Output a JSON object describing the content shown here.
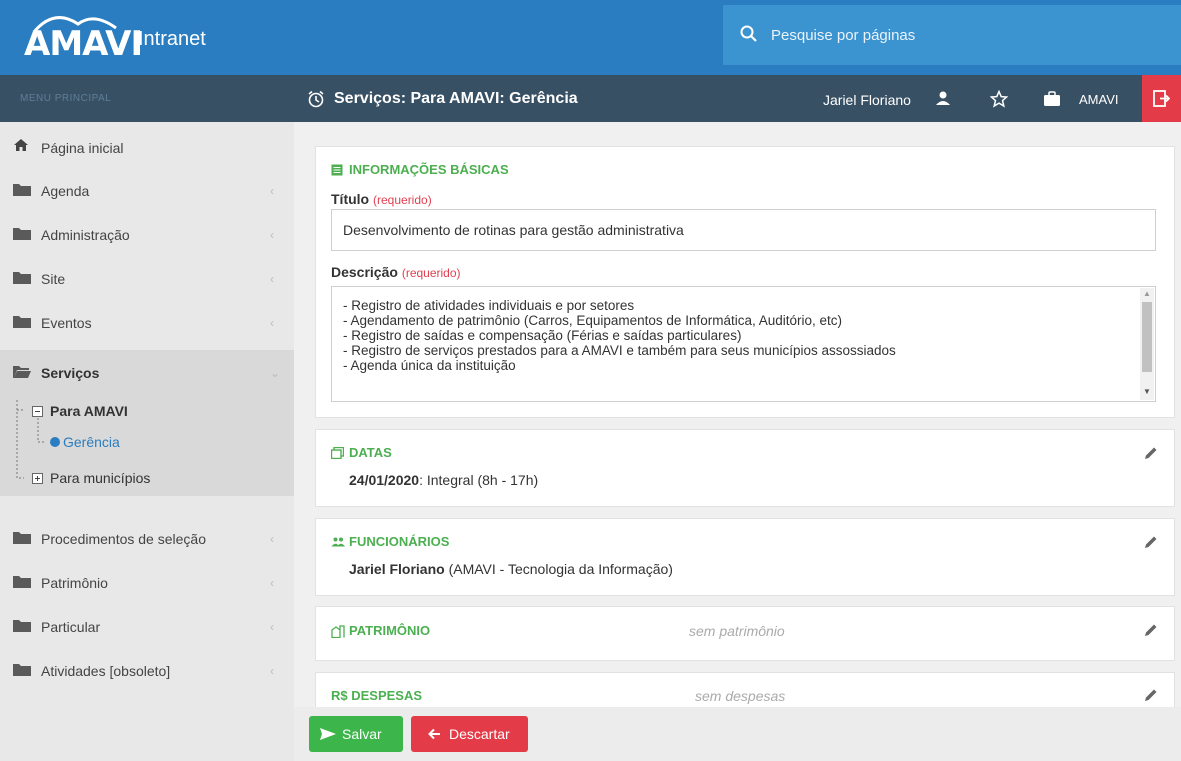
{
  "header": {
    "logo_text": "AMAVI",
    "app_title": "Intranet",
    "search_placeholder": "Pesquise por páginas"
  },
  "navbar": {
    "menu_label": "MENU PRINCIPAL",
    "page_title": "Serviços: Para AMAVI: Gerência",
    "user_name": "Jariel Floriano",
    "org_label": "AMAVI"
  },
  "sidebar": {
    "items": [
      {
        "label": "Página inicial",
        "icon": "home-icon"
      },
      {
        "label": "Agenda",
        "icon": "folder-icon"
      },
      {
        "label": "Administração",
        "icon": "folder-icon"
      },
      {
        "label": "Site",
        "icon": "folder-icon"
      },
      {
        "label": "Eventos",
        "icon": "folder-icon"
      },
      {
        "label": "Serviços",
        "icon": "folder-open-icon"
      },
      {
        "label": "Procedimentos de seleção",
        "icon": "folder-icon"
      },
      {
        "label": "Patrimônio",
        "icon": "folder-icon"
      },
      {
        "label": "Particular",
        "icon": "folder-icon"
      },
      {
        "label": "Atividades [obsoleto]",
        "icon": "folder-icon"
      }
    ],
    "tree": {
      "para_amavi": "Para AMAVI",
      "gerencia": "Gerência",
      "para_municipios": "Para municípios"
    }
  },
  "basic_info": {
    "section_title": "INFORMAÇÕES BÁSICAS",
    "title_label": "Título",
    "title_required": "(requerido)",
    "title_value": "Desenvolvimento de rotinas para gestão administrativa",
    "description_label": "Descrição",
    "description_required": "(requerido)",
    "description_lines": [
      "- Registro de atividades individuais e por setores",
      "- Agendamento de patrimônio (Carros, Equipamentos de Informática, Auditório, etc)",
      "- Registro de saídas e compensação (Férias e saídas particulares)",
      "- Registro de serviços prestados para a AMAVI e também para seus municípios assossiados",
      "- Agenda única da instituição"
    ]
  },
  "dates": {
    "section_title": "DATAS",
    "date": "24/01/2020",
    "detail": ": Integral (8h - 17h)"
  },
  "employees": {
    "section_title": "FUNCIONÁRIOS",
    "name": "Jariel Floriano",
    "detail": " (AMAVI - Tecnologia da Informação)"
  },
  "assets": {
    "section_title": "PATRIMÔNIO",
    "empty_text": "sem patrimônio"
  },
  "expenses": {
    "section_title": "R$ DESPESAS",
    "empty_text": "sem despesas"
  },
  "footer": {
    "save_label": "Salvar",
    "discard_label": "Descartar"
  },
  "colors": {
    "header_blue": "#2a7dc0",
    "navbar": "#385064",
    "accent_green": "#4caf50",
    "danger_red": "#e33c48"
  }
}
